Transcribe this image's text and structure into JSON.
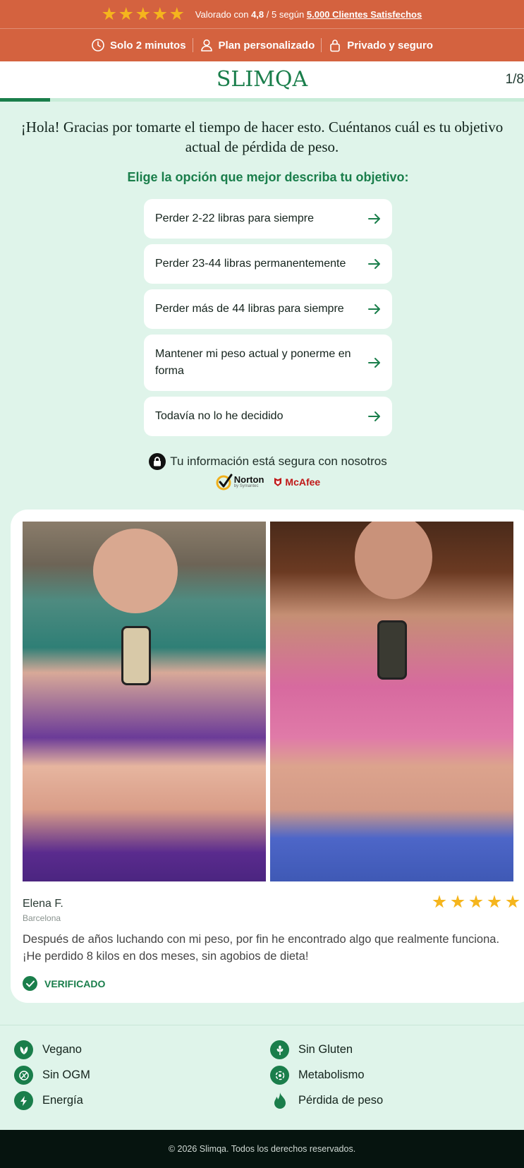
{
  "banner": {
    "rating_prefix": "Valorado con",
    "rating_value": "4,8",
    "rating_middle": "/ 5 según",
    "rating_clients": "5.000 Clientes Satisfechos",
    "features": [
      "Solo 2 minutos",
      "Plan personalizado",
      "Privado y seguro"
    ]
  },
  "header": {
    "logo": "SLIMQA",
    "step": "1/8",
    "progress": 0.125
  },
  "quiz": {
    "intro": "¡Hola! Gracias por tomarte el tiempo de hacer esto. Cuéntanos cuál es tu objetivo actual de pérdida de peso.",
    "subtitle": "Elige la opción que mejor describa tu objetivo:",
    "options": [
      "Perder 2-22 libras para siempre",
      "Perder 23-44 libras permanentemente",
      "Perder más de 44 libras para siempre",
      "Mantener mi peso actual y ponerme en forma",
      "Todavía no lo he decidido"
    ]
  },
  "security": {
    "text": "Tu información está segura con nosotros",
    "norton": "Norton",
    "norton_sub": "by Symantec",
    "mcafee": "McAfee"
  },
  "review": {
    "name": "Elena F.",
    "location": "Barcelona",
    "rating": 5,
    "text": "Después de años luchando con mi peso, por fin he encontrado algo que realmente funciona. ¡He perdido 8 kilos en dos meses, sin agobios de dieta!",
    "verified": "VERIFICADO"
  },
  "properties": [
    "Vegano",
    "Sin Gluten",
    "Sin OGM",
    "Metabolismo",
    "Energía",
    "Pérdida de peso"
  ],
  "footer": {
    "copyright": "© 2026 Slimqa. Todos los derechos reservados."
  },
  "colors": {
    "banner": "#d4623f",
    "brand_green": "#1a7e4b",
    "background": "#dff4ea",
    "star": "#f5b51d",
    "footer": "#06140f"
  }
}
